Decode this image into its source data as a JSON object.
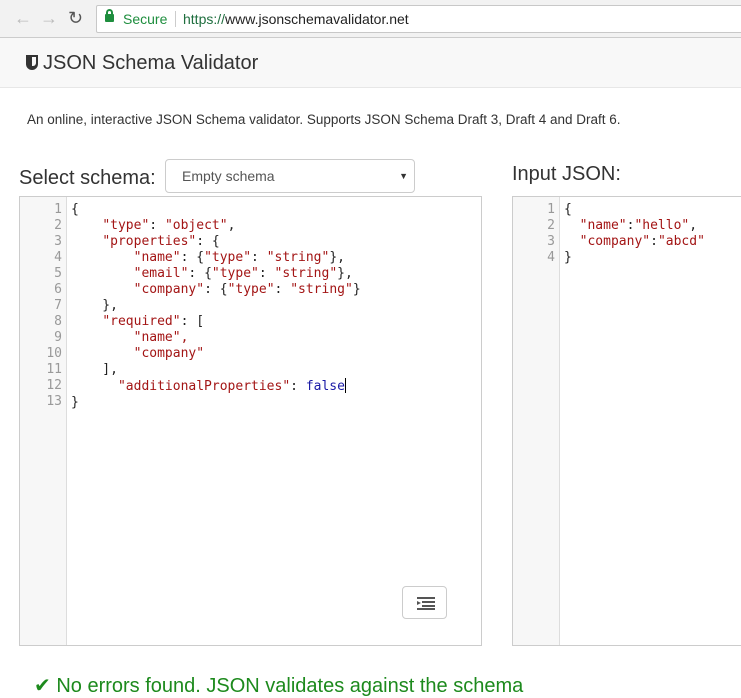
{
  "browser": {
    "back_icon": "arrow-left",
    "forward_icon": "arrow-right",
    "reload_icon": "reload",
    "secure_label": "Secure",
    "url_scheme": "https://",
    "url_host": "www.jsonschemavalidator.net"
  },
  "navbar": {
    "title": "JSON Schema Validator",
    "icon": "shield-icon"
  },
  "description": "An online, interactive JSON Schema validator. Supports JSON Schema Draft 3, Draft 4 and Draft 6.",
  "schema": {
    "label": "Select schema:",
    "selected": "Empty schema",
    "lines": [
      "{",
      "    \"type\": \"object\",",
      "    \"properties\": {",
      "        \"name\": {\"type\": \"string\"},",
      "        \"email\": {\"type\": \"string\"},",
      "        \"company\": {\"type\": \"string\"}",
      "    },",
      "    \"required\": [",
      "        \"name\",",
      "        \"company\"",
      "    ],",
      "      \"additionalProperties\": false",
      "}"
    ]
  },
  "input": {
    "label": "Input JSON:",
    "lines": [
      "{",
      "  \"name\":\"hello\",",
      "  \"company\":\"abcd\"",
      "}"
    ]
  },
  "result": {
    "message": "No errors found. JSON validates against the schema",
    "color": "#1d8a1d"
  },
  "colors": {
    "string": "#a31515",
    "keyword": "#1a1aa6"
  }
}
